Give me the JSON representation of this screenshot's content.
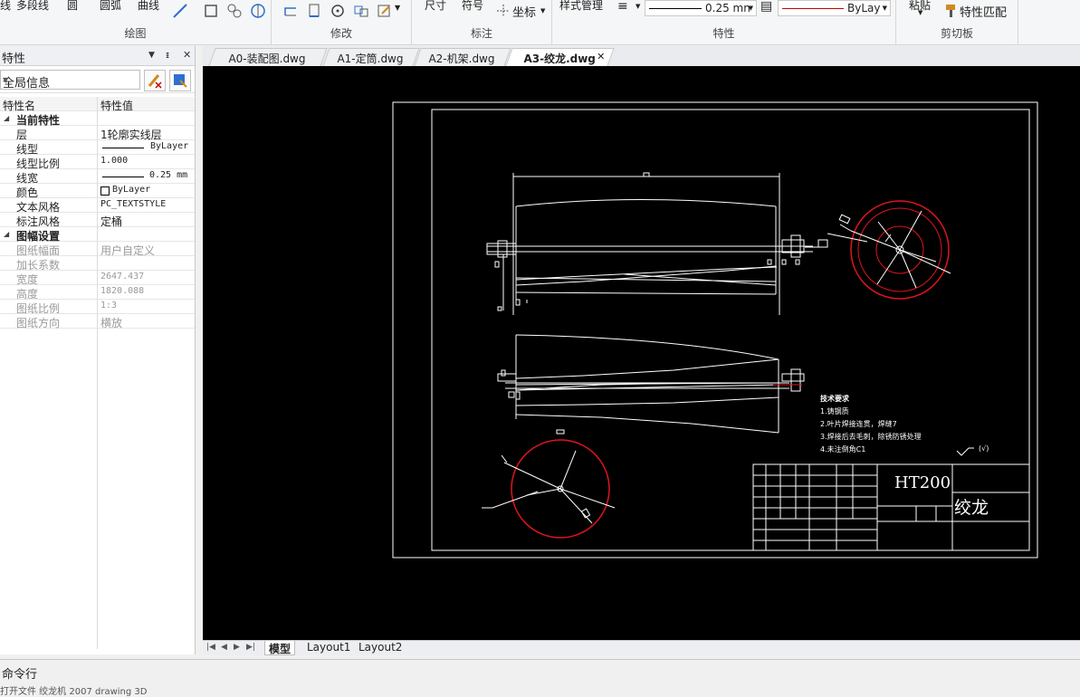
{
  "ribbon": {
    "groups": {
      "draw": "绘图",
      "modify": "修改",
      "annotate": "标注",
      "properties": "特性",
      "clipboard": "剪切板"
    },
    "draw_buttons": {
      "line": "线",
      "polyline": "多段线",
      "circle": "圆",
      "arc": "圆弧",
      "curve": "曲线"
    },
    "annotate_buttons": {
      "dimension": "尺寸",
      "symbol": "符号",
      "coordinate": "坐标"
    },
    "style_manager": "样式管理",
    "lineweight_value": "0.25 mn",
    "color_value": "ByLay",
    "paste": "粘贴",
    "match_properties": "特性匹配"
  },
  "properties_panel": {
    "title": "特性",
    "selection": "全局信息",
    "header_name": "特性名",
    "header_value": "特性值",
    "rows": [
      {
        "type": "cat",
        "name": "当前特性"
      },
      {
        "type": "row",
        "name": "层",
        "value": "1轮廓实线层"
      },
      {
        "type": "row",
        "name": "线型",
        "value": "ByLayer",
        "swatch": "line"
      },
      {
        "type": "row",
        "name": "线型比例",
        "value": "1.000"
      },
      {
        "type": "row",
        "name": "线宽",
        "value": "0.25 mm",
        "swatch": "line"
      },
      {
        "type": "row",
        "name": "颜色",
        "value": "ByLayer",
        "swatch": "box"
      },
      {
        "type": "row",
        "name": "文本风格",
        "value": "PC_TEXTSTYLE"
      },
      {
        "type": "row",
        "name": "标注风格",
        "value": "定桶"
      },
      {
        "type": "cat",
        "name": "图幅设置"
      },
      {
        "type": "dis",
        "name": "图纸幅面",
        "value": "用户自定义"
      },
      {
        "type": "dis",
        "name": "加长系数",
        "value": ""
      },
      {
        "type": "dis",
        "name": "宽度",
        "value": "2647.437"
      },
      {
        "type": "dis",
        "name": "高度",
        "value": "1820.088"
      },
      {
        "type": "dis",
        "name": "图纸比例",
        "value": "1:3"
      },
      {
        "type": "dis",
        "name": "图纸方向",
        "value": "横放"
      }
    ]
  },
  "doc_tabs": [
    "A0-装配图.dwg",
    "A1-定筒.dwg",
    "A2-机架.dwg",
    "A3-绞龙.dwg"
  ],
  "active_tab": "A3-绞龙.dwg",
  "drawing": {
    "material": "HT200",
    "part_name": "绞龙",
    "tech_title": "技术要求",
    "tech_notes": [
      "1.铸钢质",
      "2.叶片焊接连贯，焊缝7",
      "3.焊接后去毛刺，除锈防锈处理",
      "4.未注倒角C1"
    ],
    "roughness": "(√)"
  },
  "layout_tabs": [
    "模型",
    "Layout1",
    "Layout2"
  ],
  "active_layout": "模型",
  "command_line": {
    "title": "命令行",
    "text": "打开文件 绞龙机 2007 drawing 3D"
  },
  "colors": {
    "canvas": "#000000",
    "drawing_line": "#ffffff",
    "red_circle": "#e0141e"
  }
}
